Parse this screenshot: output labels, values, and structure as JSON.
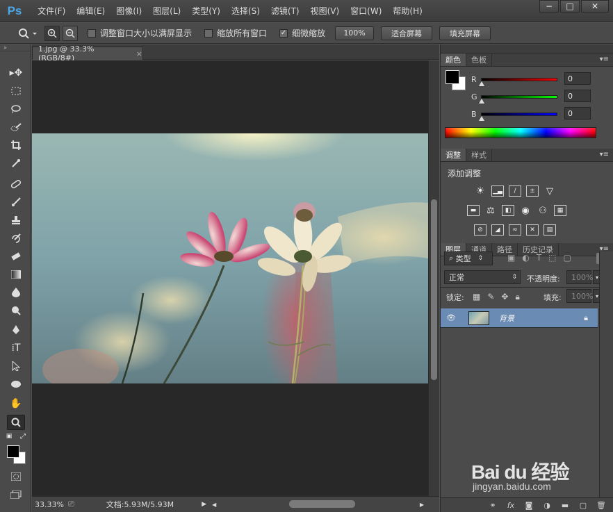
{
  "app": {
    "logo": "Ps"
  },
  "menu": [
    "文件(F)",
    "编辑(E)",
    "图像(I)",
    "图层(L)",
    "类型(Y)",
    "选择(S)",
    "滤镜(T)",
    "视图(V)",
    "窗口(W)",
    "帮助(H)"
  ],
  "window_controls": {
    "minimize": "−",
    "maximize": "□",
    "close": "✕"
  },
  "options": {
    "resize_windows": {
      "label": "调整窗口大小以满屏显示",
      "checked": false
    },
    "zoom_all": {
      "label": "缩放所有窗口",
      "checked": false
    },
    "scrubby_zoom": {
      "label": "细微缩放",
      "checked": true
    },
    "btn_100": "100%",
    "btn_fit": "适合屏幕",
    "btn_fill": "填充屏幕"
  },
  "document": {
    "tab_title": "1.jpg @ 33.3%(RGB/8#)",
    "close": "×"
  },
  "status": {
    "zoom": "33.33%",
    "doc_info": "文档:5.93M/5.93M"
  },
  "color_panel": {
    "tabs": [
      "颜色",
      "色板"
    ],
    "channels": [
      {
        "label": "R",
        "value": "0",
        "color": "#e03030"
      },
      {
        "label": "G",
        "value": "0",
        "color": "#30c030"
      },
      {
        "label": "B",
        "value": "0",
        "color": "#3040e0"
      }
    ]
  },
  "adjust_panel": {
    "tabs": [
      "调整",
      "样式"
    ],
    "title": "添加调整"
  },
  "layers_panel": {
    "tabs": [
      "图层",
      "通道",
      "路径",
      "历史记录"
    ],
    "filter_kind": "类型",
    "blend_mode": "正常",
    "opacity_label": "不透明度:",
    "opacity_value": "100%",
    "lock_label": "锁定:",
    "fill_label": "填充:",
    "fill_value": "100%",
    "layer_name": "背景"
  },
  "watermark": {
    "logo": "Bai du 经验",
    "url": "jingyan.baidu.com"
  }
}
